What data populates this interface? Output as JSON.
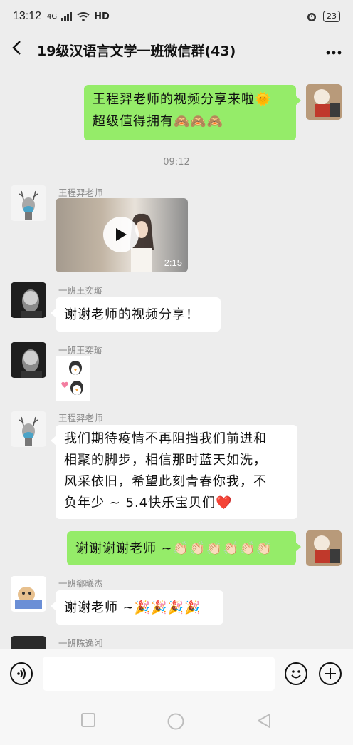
{
  "status_bar": {
    "time": "13:12",
    "network": "4G",
    "hd": "HD",
    "battery": "23"
  },
  "header": {
    "title": "19级汉语言文学一班微信群(43)"
  },
  "messages": [
    {
      "type": "text",
      "side": "right",
      "lines": [
        "王程羿老师的视频分享来啦🌞",
        "超级值得拥有🙈🙈🙈"
      ]
    },
    {
      "type": "time",
      "text": "09:12"
    },
    {
      "type": "video",
      "side": "left",
      "sender": "王程羿老师",
      "duration": "2:15"
    },
    {
      "type": "text",
      "side": "left",
      "sender": "一班王奕璇",
      "lines": [
        "谢谢老师的视频分享！"
      ]
    },
    {
      "type": "sticker",
      "side": "left",
      "sender": "一班王奕璇"
    },
    {
      "type": "text",
      "side": "left",
      "sender": "王程羿老师",
      "lines": [
        "我们期待疫情不再阻挡我们前进和",
        "相聚的脚步，相信那时蓝天如洗，",
        "风采依旧，希望此刻青春你我，不",
        "负年少 ~ 5.4快乐宝贝们❤️"
      ]
    },
    {
      "type": "text",
      "side": "right",
      "lines": [
        "谢谢谢谢老师 ~👏🏻👏🏻👏🏻👏🏻👏🏻👏🏻"
      ]
    },
    {
      "type": "text",
      "side": "left",
      "sender": "一班郗曦杰",
      "lines": [
        "谢谢老师 ~🎉🎉🎉🎉"
      ]
    },
    {
      "type": "partial",
      "side": "left",
      "sender": "一班陈逸湘"
    }
  ],
  "colors": {
    "bubble_green": "#95ec69",
    "bubble_white": "#ffffff",
    "background": "#ededed"
  },
  "icons": [
    "back-icon",
    "more-icon",
    "play-icon",
    "voice-icon",
    "emoji-icon",
    "plus-icon"
  ]
}
